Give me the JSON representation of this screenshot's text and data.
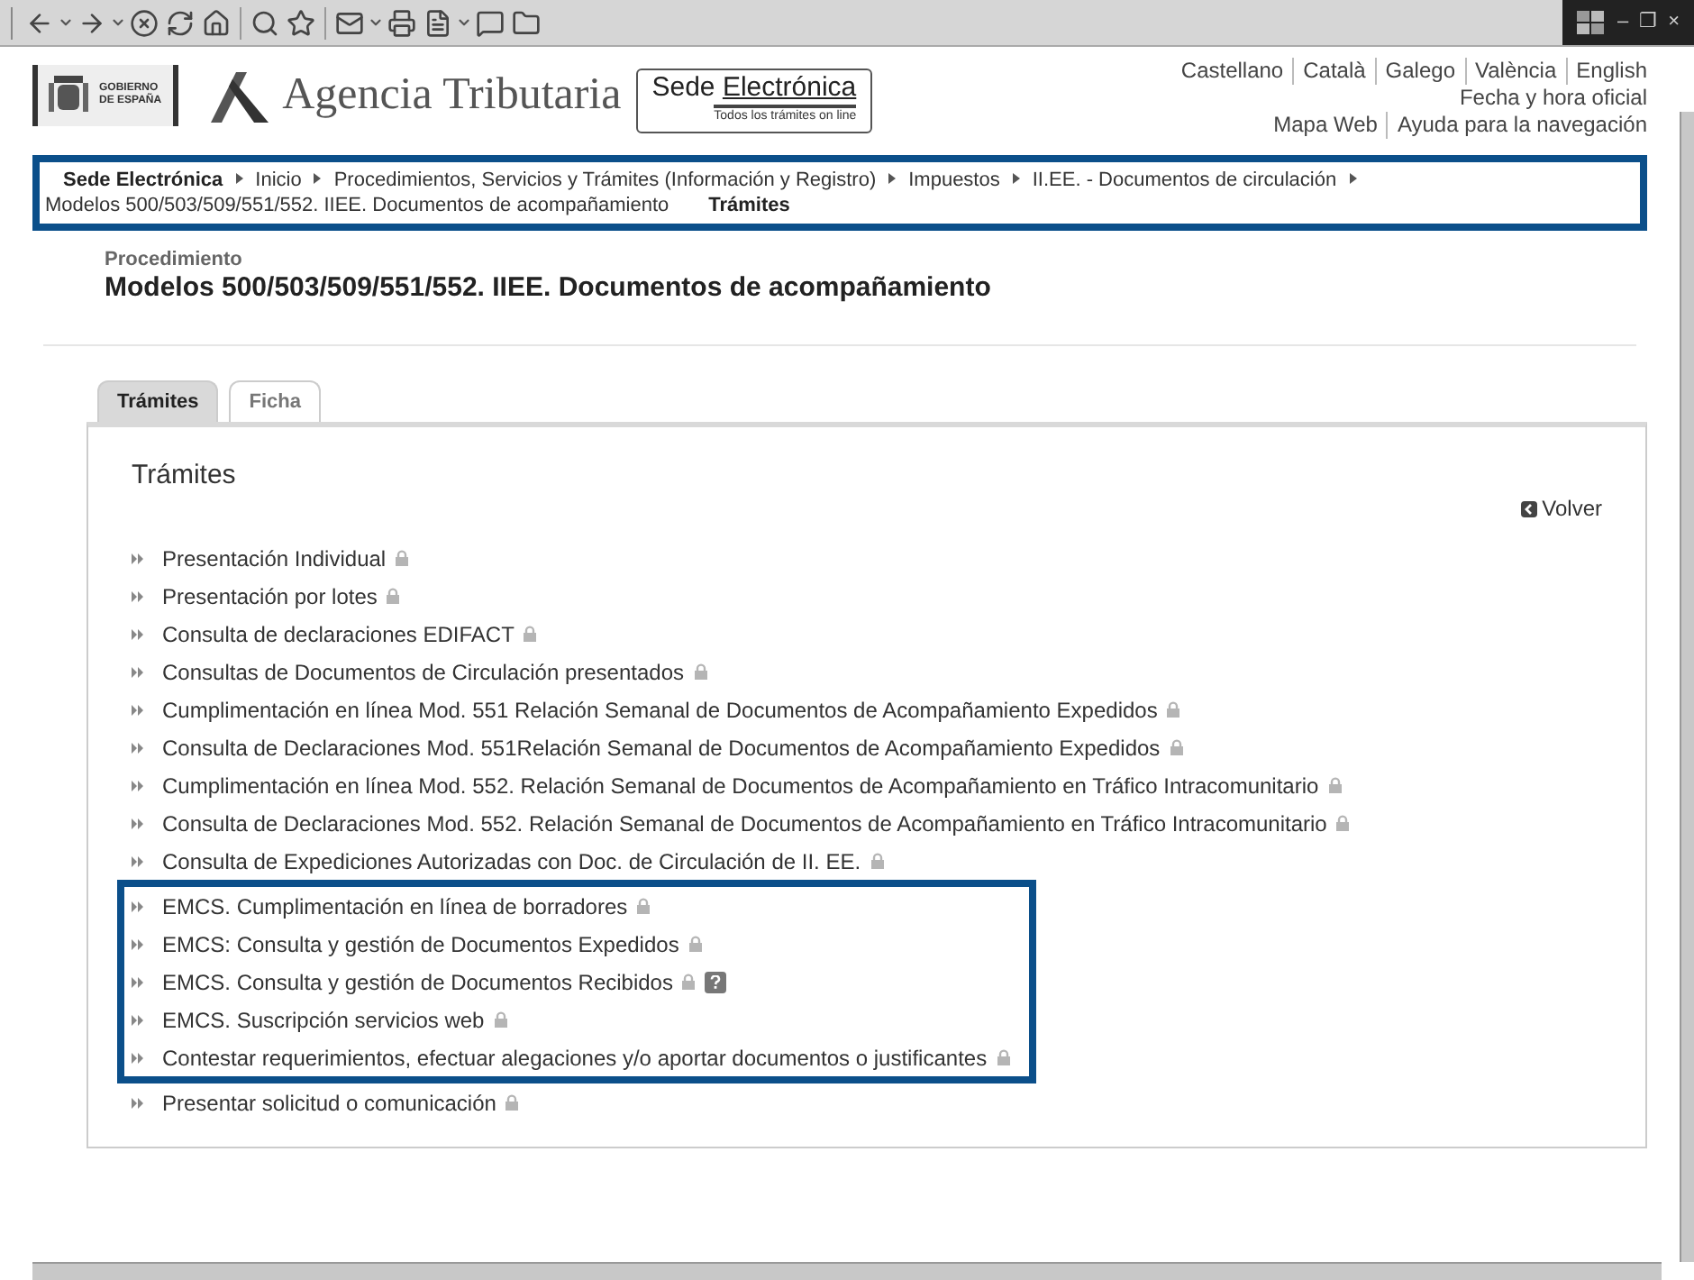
{
  "toolbar": {
    "window_controls": [
      "–",
      "❐",
      "×"
    ]
  },
  "header": {
    "gov_logo": [
      "GOBIERNO",
      "DE ESPAÑA"
    ],
    "agency": "Agencia Tributaria",
    "sede": {
      "title": "Sede ",
      "title_underlined": "Electrónica",
      "tagline": "Todos los trámites on line"
    },
    "languages": [
      "Castellano",
      "Català",
      "Galego",
      "València",
      "English"
    ],
    "official_time": "Fecha y hora oficial",
    "links": [
      "Mapa Web",
      "Ayuda para la navegación"
    ]
  },
  "breadcrumb": {
    "highlighted": true,
    "items": [
      {
        "label": "Sede Electrónica",
        "kind": "root"
      },
      {
        "label": "Inicio",
        "kind": "link"
      },
      {
        "label": "Procedimientos, Servicios y Trámites (Información y Registro)",
        "kind": "link"
      },
      {
        "label": "Impuestos",
        "kind": "link"
      },
      {
        "label": "II.EE. - Documentos de circulación",
        "kind": "link"
      },
      {
        "label": "Modelos 500/503/509/551/552. IIEE. Documentos de acompañamiento",
        "kind": "link"
      },
      {
        "label": "Trámites",
        "kind": "current"
      }
    ]
  },
  "procedure": {
    "label": "Procedimiento",
    "title": "Modelos 500/503/509/551/552. IIEE. Documentos de acompañamiento"
  },
  "tabs": [
    {
      "label": "Trámites",
      "selected": true
    },
    {
      "label": "Ficha",
      "selected": false
    }
  ],
  "panel": {
    "heading": "Trámites",
    "back_link": "Volver",
    "groups": [
      {
        "highlighted": false,
        "items": [
          {
            "label": "Presentación Individual",
            "locked": true,
            "help": false
          },
          {
            "label": "Presentación por lotes",
            "locked": true,
            "help": false
          },
          {
            "label": "Consulta de declaraciones EDIFACT",
            "locked": true,
            "help": false
          },
          {
            "label": "Consultas de Documentos de Circulación presentados",
            "locked": true,
            "help": false
          },
          {
            "label": "Cumplimentación en línea Mod. 551 Relación Semanal de Documentos de Acompañamiento Expedidos",
            "locked": true,
            "help": false
          },
          {
            "label": "Consulta de Declaraciones Mod. 551Relación Semanal de Documentos de Acompañamiento Expedidos",
            "locked": true,
            "help": false
          },
          {
            "label": "Cumplimentación en línea Mod. 552. Relación Semanal de Documentos de Acompañamiento en Tráfico Intracomunitario",
            "locked": true,
            "help": false
          },
          {
            "label": "Consulta de Declaraciones Mod. 552. Relación Semanal de Documentos de Acompañamiento en Tráfico Intracomunitario",
            "locked": true,
            "help": false
          },
          {
            "label": "Consulta de Expediciones Autorizadas con Doc. de Circulación de II. EE.",
            "locked": true,
            "help": false
          }
        ]
      },
      {
        "highlighted": true,
        "items": [
          {
            "label": "EMCS. Cumplimentación en línea de borradores",
            "locked": true,
            "help": false
          },
          {
            "label": "EMCS: Consulta y gestión de Documentos Expedidos",
            "locked": true,
            "help": false
          },
          {
            "label": "EMCS. Consulta y gestión de Documentos Recibidos",
            "locked": true,
            "help": true
          },
          {
            "label": "EMCS. Suscripción servicios web",
            "locked": true,
            "help": false
          },
          {
            "label": "Contestar requerimientos, efectuar alegaciones y/o aportar documentos o justificantes",
            "locked": true,
            "help": false
          }
        ]
      },
      {
        "highlighted": false,
        "items": [
          {
            "label": "Presentar solicitud o comunicación",
            "locked": true,
            "help": false
          }
        ]
      }
    ]
  }
}
